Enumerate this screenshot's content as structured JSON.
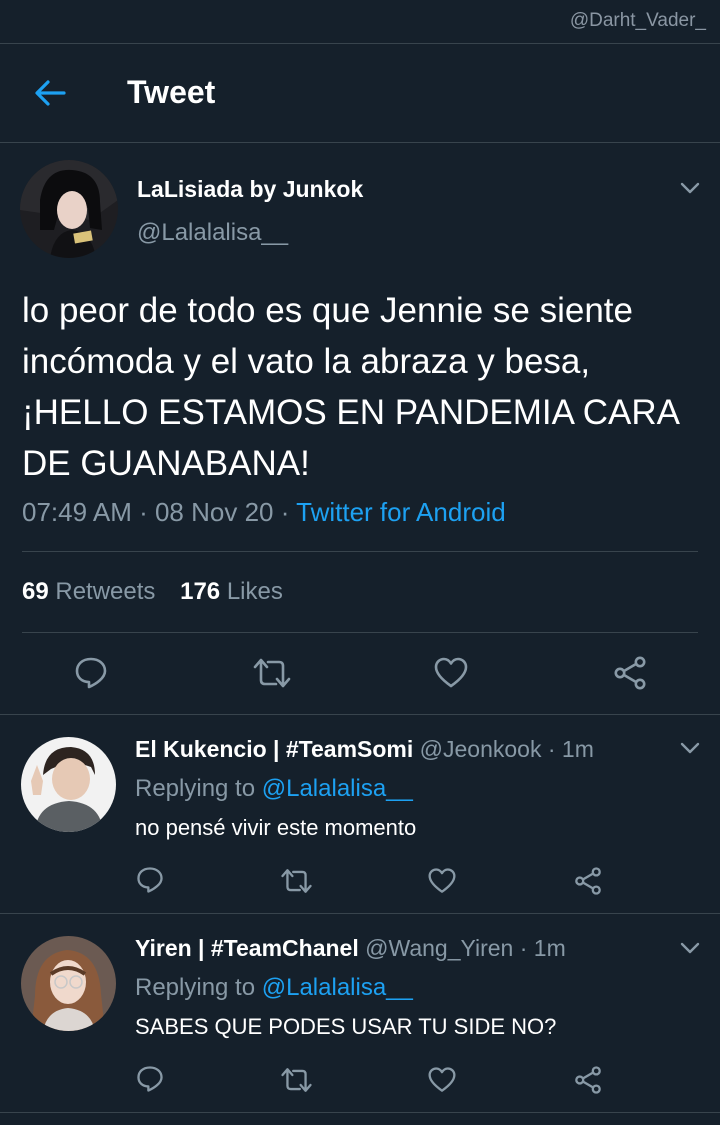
{
  "watermark": "@Darht_Vader_",
  "header": {
    "title": "Tweet"
  },
  "tweet": {
    "author_name": "LaLisiada by Junkok",
    "author_handle": "@Lalalalisa__",
    "text": "lo peor de todo es que Jennie se siente incómoda y el vato la abraza y besa, ¡HELLO ESTAMOS EN PANDEMIA CARA DE GUANABANA!",
    "time": "07:49 AM",
    "date": "08 Nov 20",
    "separator": " · ",
    "source": "Twitter for Android",
    "retweets_count": "69",
    "retweets_label": "Retweets",
    "likes_count": "176",
    "likes_label": "Likes"
  },
  "replies": [
    {
      "name": "El Kukencio | #TeamSomi",
      "handle": "@Jeonkook",
      "time": "1m",
      "replying_label": "Replying to",
      "replying_to": "@Lalalalisa__",
      "text": "no pensé vivir este momento"
    },
    {
      "name": "Yiren | #TeamChanel",
      "handle": "@Wang_Yiren",
      "time": "1m",
      "replying_label": "Replying to",
      "replying_to": "@Lalalalisa__",
      "text": "SABES QUE PODES USAR TU SIDE NO?"
    }
  ],
  "icons": {
    "back": "arrow-left-icon",
    "more": "chevron-down-icon",
    "reply": "speech-bubble-icon",
    "retweet": "retweet-icon",
    "like": "heart-icon",
    "share": "share-icon"
  },
  "colors": {
    "background": "#15202b",
    "accent": "#1da1f2",
    "secondary_text": "#8899a6",
    "divider": "#38444d"
  }
}
